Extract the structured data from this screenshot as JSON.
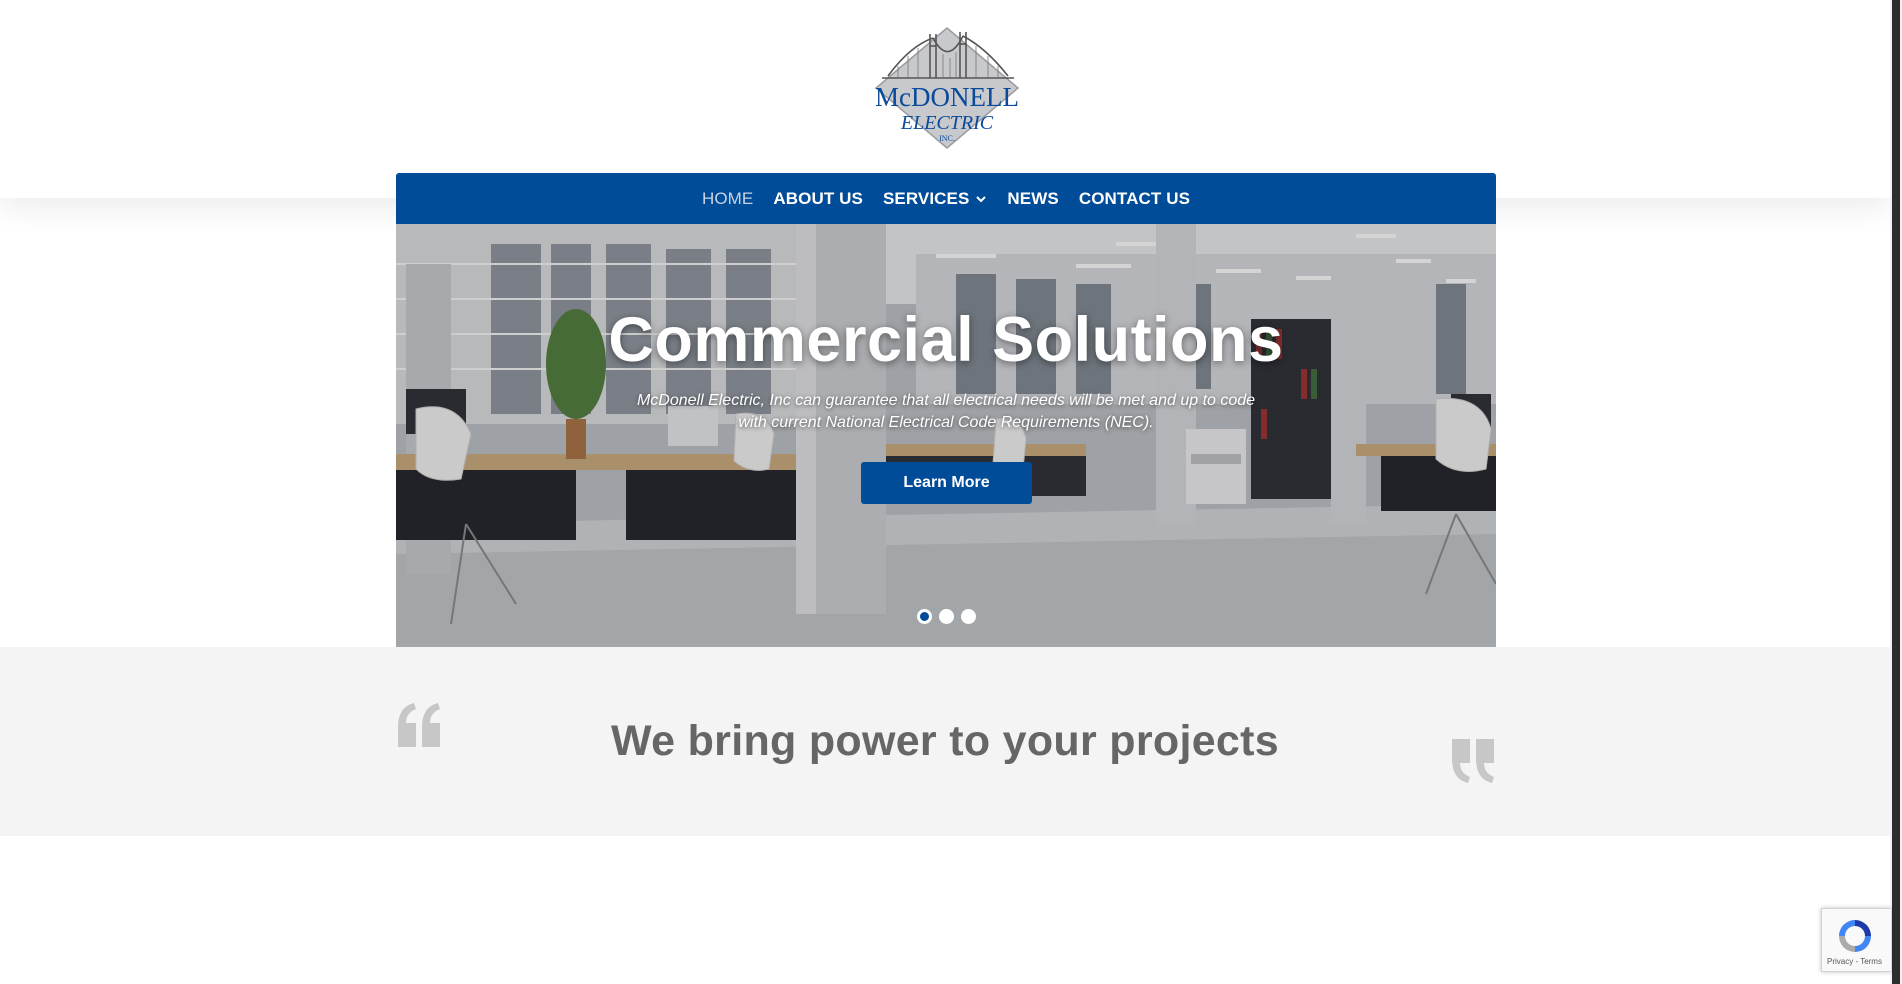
{
  "brand": {
    "logo_line1": "McDONELL",
    "logo_line2": "ELECTRIC",
    "logo_line3": "INC."
  },
  "nav": {
    "items": [
      {
        "label": "HOME",
        "active": true
      },
      {
        "label": "ABOUT US"
      },
      {
        "label": "SERVICES",
        "has_dropdown": true
      },
      {
        "label": "NEWS"
      },
      {
        "label": "CONTACT US"
      }
    ]
  },
  "hero": {
    "title": "Commercial Solutions",
    "subtitle_line1": "McDonell Electric, Inc can guarantee that all electrical needs will be met and up to code",
    "subtitle_line2": "with current National Electrical Code Requirements (NEC).",
    "button_label": "Learn More",
    "slide_count": 3,
    "active_slide": 1
  },
  "quote": {
    "text": "We bring power to your projects"
  },
  "recaptcha": {
    "links": "Privacy - Terms"
  },
  "colors": {
    "brand_blue": "#004c99",
    "quote_band": "#f4f4f4",
    "quote_text": "#666666"
  }
}
